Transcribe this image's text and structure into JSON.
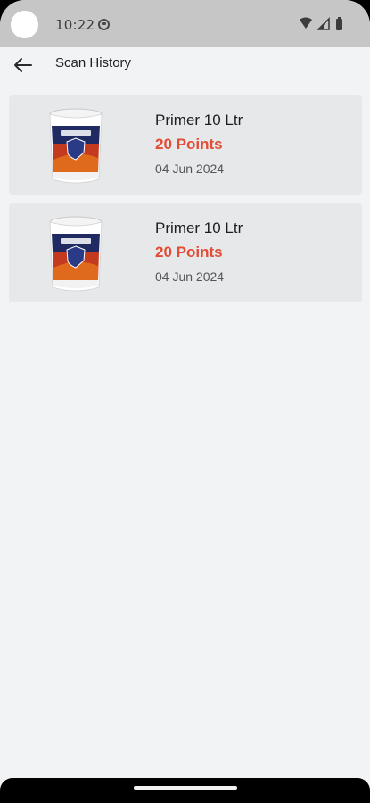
{
  "status_bar": {
    "time": "10:22",
    "icons": [
      "notification-icon",
      "wifi-icon",
      "signal-icon",
      "battery-icon"
    ]
  },
  "app_bar": {
    "back_icon": "arrow-left-icon",
    "title": "Scan History"
  },
  "history": {
    "items": [
      {
        "product": "Primer 10 Ltr",
        "points": "20 Points",
        "date": "04 Jun 2024",
        "thumb_icon": "paint-bucket-icon"
      },
      {
        "product": "Primer 10 Ltr",
        "points": "20 Points",
        "date": "04 Jun 2024",
        "thumb_icon": "paint-bucket-icon"
      }
    ]
  },
  "colors": {
    "background": "#f2f3f5",
    "card": "#e7e8ea",
    "points": "#e34b34",
    "status_bar": "#c6c6c6"
  }
}
